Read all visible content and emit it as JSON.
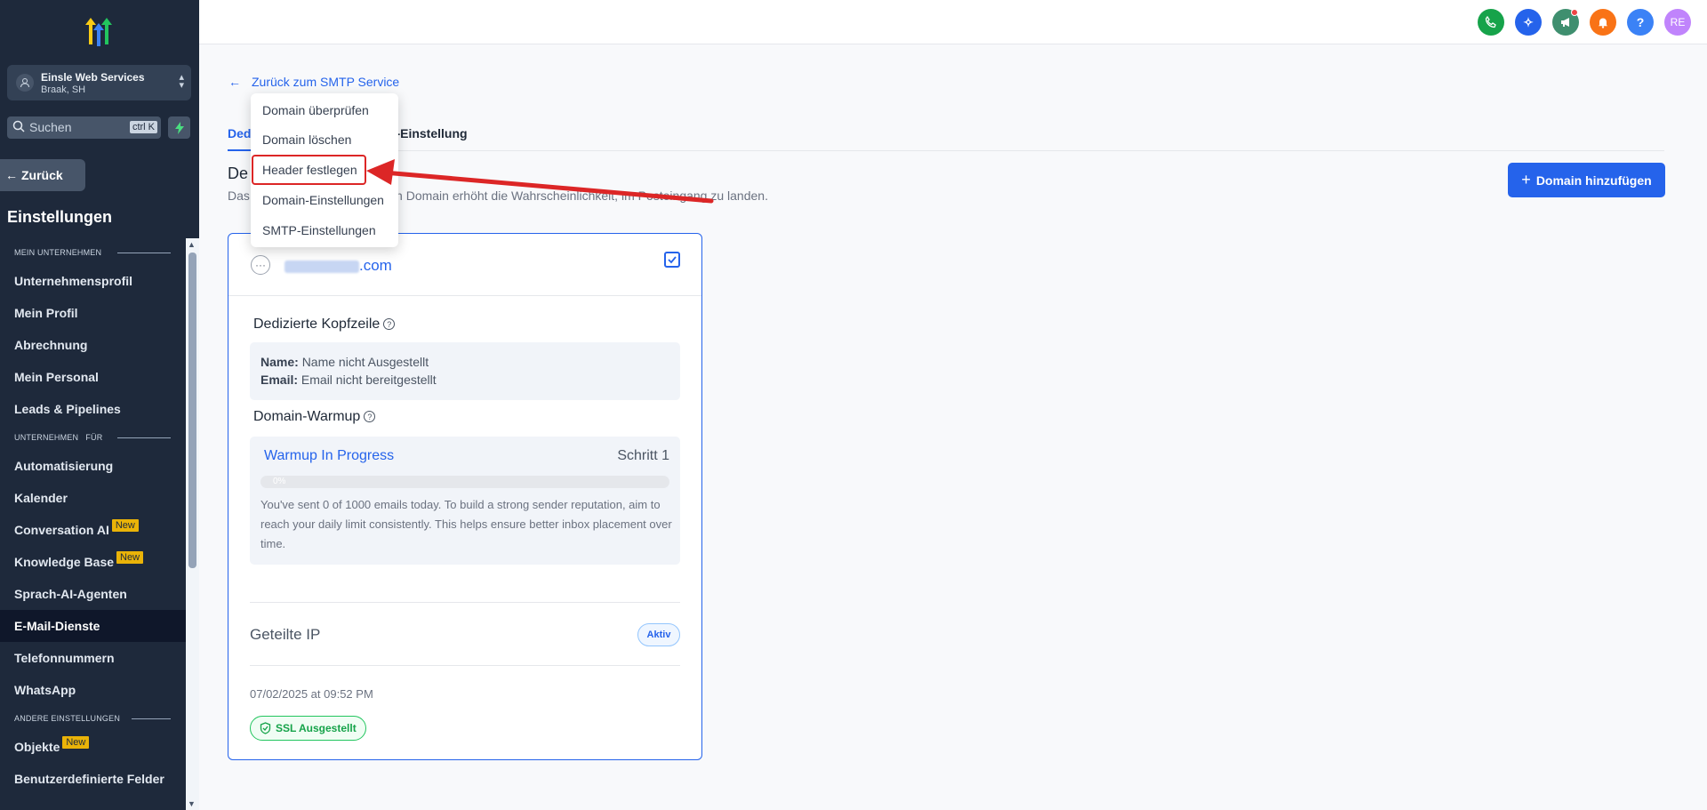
{
  "sidebar": {
    "account": {
      "name": "Einsle Web Services",
      "location": "Braak, SH"
    },
    "search": {
      "placeholder": "Suchen",
      "shortcut": "ctrl K"
    },
    "back_label": "Zurück",
    "title": "Einstellungen",
    "sections": [
      {
        "label": "MEIN UNTERNEHMEN",
        "items": [
          "Unternehmensprofil",
          "Mein Profil",
          "Abrechnung",
          "Mein Personal",
          "Leads & Pipelines"
        ]
      },
      {
        "label": "UNTERNEHMEN   FÜR",
        "items": [
          "Automatisierung",
          "Kalender",
          "Conversation AI",
          "Knowledge Base",
          "Sprach-AI-Agenten",
          "E-Mail-Dienste",
          "Telefonnummern",
          "WhatsApp"
        ]
      },
      {
        "label": "ANDERE EINSTELLUNGEN",
        "items": [
          "Objekte",
          "Benutzerdefinierte Felder"
        ]
      }
    ],
    "new_badge": "New",
    "active_item": "E-Mail-Dienste"
  },
  "topbar": {
    "icons": [
      {
        "name": "phone-icon",
        "color": "#16a34a"
      },
      {
        "name": "ai-sparkle-icon",
        "color": "#2563eb"
      },
      {
        "name": "megaphone-icon",
        "color": "#3f8f6f"
      },
      {
        "name": "bell-icon",
        "color": "#f97316"
      },
      {
        "name": "help-icon",
        "color": "#3b82f6"
      }
    ],
    "avatar_initials": "RE",
    "avatar_color": "#c084fc"
  },
  "main": {
    "back_link": "Zurück zum SMTP Service",
    "tabs": [
      "Dedi",
      "in-Einstellung"
    ],
    "heading": "De",
    "description_prefix": "Das",
    "description": "erten Domain erhöht die Wahrscheinlichkeit, im Posteingang zu landen.",
    "add_button": "Domain hinzufügen"
  },
  "card": {
    "domain_suffix": ".com",
    "dedicated_header": {
      "title": "Dedizierte Kopfzeile",
      "name_label": "Name:",
      "name_value": "Name nicht Ausgestellt",
      "email_label": "Email:",
      "email_value": "Email nicht bereitgestellt"
    },
    "warmup": {
      "title": "Domain-Warmup",
      "status": "Warmup In Progress",
      "step": "Schritt 1",
      "progress_label": "0%",
      "progress": 0,
      "text": "You've sent 0 of 1000 emails today. To build a strong sender reputation, aim to reach your daily limit consistently. This helps ensure better inbox placement over time."
    },
    "shared_ip": "Geteilte IP",
    "shared_ip_status": "Aktiv",
    "date": "07/02/2025 at 09:52 PM",
    "ssl": "SSL Ausgestellt"
  },
  "dropdown": {
    "items": [
      "Domain überprüfen",
      "Domain löschen",
      "Header festlegen",
      "Domain-Einstellungen",
      "SMTP-Einstellungen"
    ],
    "highlighted": "Header festlegen"
  },
  "colors": {
    "accent": "#2563eb",
    "annotation": "#dc2626",
    "sidebar": "#1e293b"
  }
}
